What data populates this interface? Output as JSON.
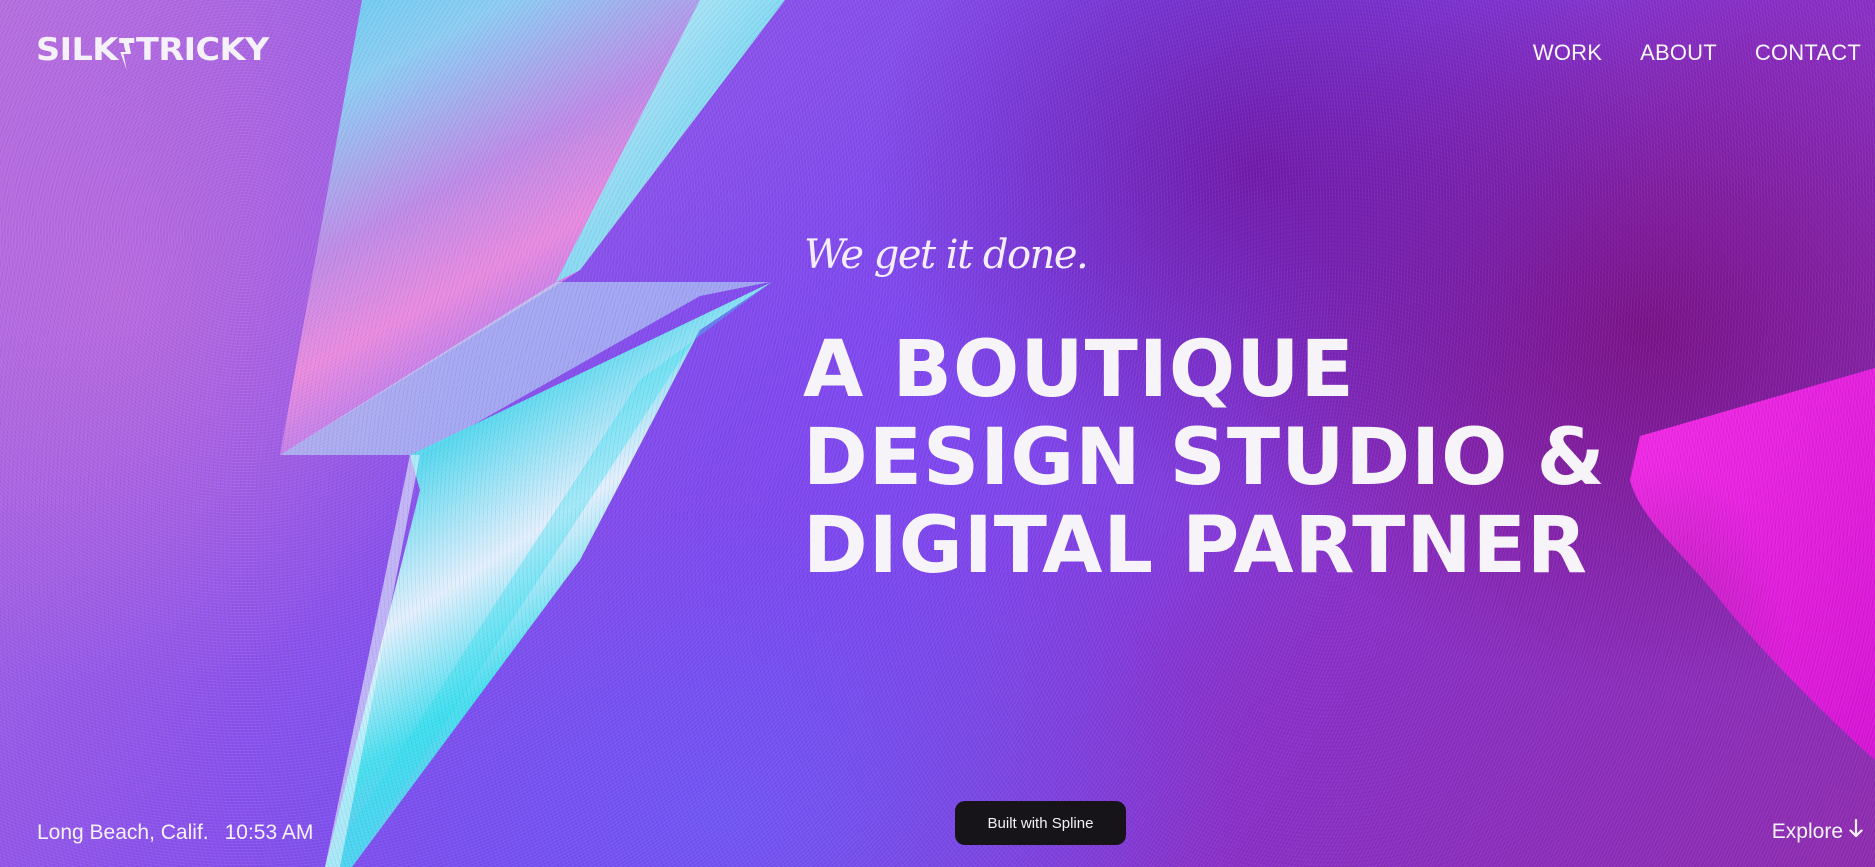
{
  "header": {
    "logo_left": "SILK",
    "logo_right": "TRICKY",
    "nav": [
      {
        "label": "WORK"
      },
      {
        "label": "ABOUT"
      },
      {
        "label": "CONTACT"
      }
    ]
  },
  "hero": {
    "tagline": "We get it done.",
    "headline": [
      "A BOUTIQUE",
      "DESIGN STUDIO &",
      "DIGITAL PARTNER"
    ]
  },
  "footer": {
    "location": "Long Beach, Calif.",
    "time": "10:53 AM",
    "built_with": "Built with Spline",
    "explore": "Explore",
    "explore_icon": "arrow-down-icon"
  },
  "colors": {
    "accent_pink": "#ec1ee0",
    "background_purple": "#7a45ee",
    "badge_bg": "#161319"
  }
}
